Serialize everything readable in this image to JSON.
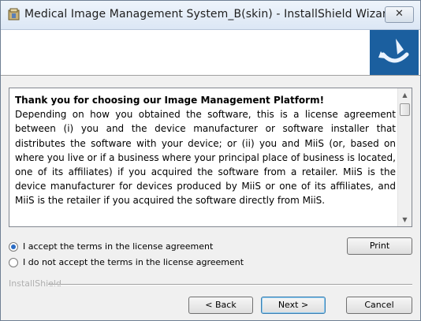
{
  "window": {
    "title": "Medical Image Management System_B(skin) - InstallShield Wizard",
    "close_label": "✕"
  },
  "banner": {
    "logo_icon": "installshield-logo-icon"
  },
  "license": {
    "heading": "Thank you for choosing our Image Management Platform!",
    "body": "Depending on how you obtained the software, this is a license agreement between (i) you and the device manufacturer or software installer that distributes the software with your device; or (ii) you and MiiS (or, based on where you live or if a business where your principal place of business is located, one of its affiliates) if you acquired the software from a retailer. MiiS is the device manufacturer for devices produced by MiiS or one of its affiliates, and MiiS is the retailer if you acquired the software directly from MiiS."
  },
  "options": {
    "accept_label": "I accept the terms in the license agreement",
    "decline_label": "I do not accept the terms in the license agreement",
    "selected": "accept"
  },
  "buttons": {
    "print": "Print",
    "back": "< Back",
    "next": "Next >",
    "cancel": "Cancel"
  },
  "footer": {
    "brand": "InstallShield"
  }
}
